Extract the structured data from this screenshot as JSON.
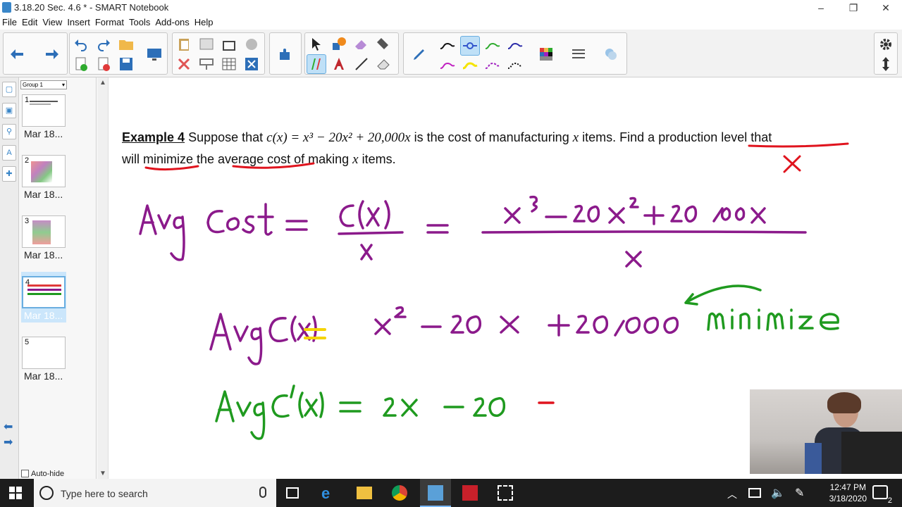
{
  "window": {
    "title": "3.18.20 Sec. 4.6 * - SMART Notebook",
    "minimize": "–",
    "restore": "❐",
    "close": "✕"
  },
  "menu": [
    "File",
    "Edit",
    "View",
    "Insert",
    "Format",
    "Tools",
    "Add-ons",
    "Help"
  ],
  "pages_panel": {
    "group": "Group 1",
    "pages": [
      {
        "num": "1",
        "label": "Mar 18..."
      },
      {
        "num": "2",
        "label": "Mar 18..."
      },
      {
        "num": "3",
        "label": "Mar 18..."
      },
      {
        "num": "4",
        "label": "Mar 18..."
      },
      {
        "num": "5",
        "label": "Mar 18..."
      }
    ],
    "selected_page": 4,
    "autohide": "Auto-hide"
  },
  "canvas": {
    "example_label": "Example 4",
    "line1_a": " Suppose that ",
    "cost_fn": "c(x) = x³ − 20x² + 20,000x",
    "line1_b": " is the cost of manufacturing ",
    "var_x": "x",
    "line1_c": " items. Find a production level that",
    "line2_a": "will minimize the average cost of making ",
    "line2_b": " items."
  },
  "taskbar": {
    "search_placeholder": "Type here to search",
    "time": "12:47 PM",
    "date": "3/18/2020",
    "notification_count": "2"
  },
  "colors": {
    "ink_purple": "#8b1a8b",
    "ink_red": "#e0141e",
    "ink_green": "#1f9a1f",
    "ink_yellow": "#f5d400"
  }
}
